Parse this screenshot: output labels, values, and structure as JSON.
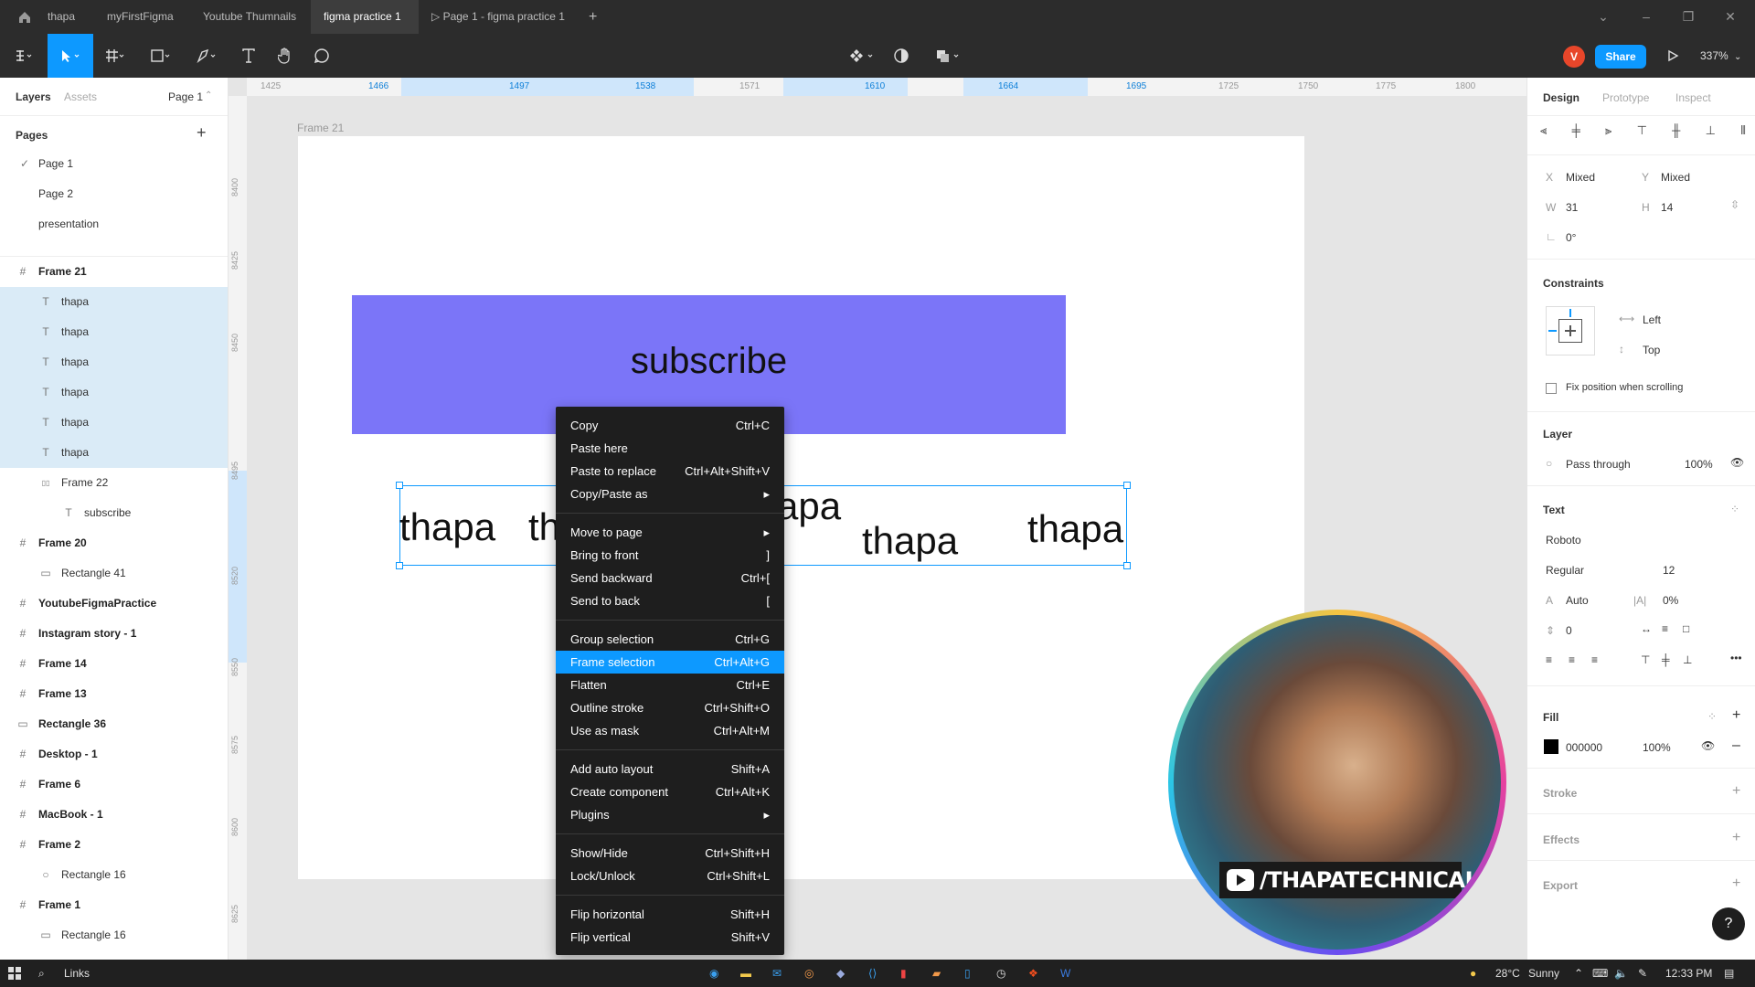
{
  "window": {
    "tabs": [
      {
        "label": "thapa"
      },
      {
        "label": "myFirstFigma"
      },
      {
        "label": "Youtube Thumnails"
      },
      {
        "label": "figma practice 1"
      },
      {
        "label": "Page 1 - figma practice 1"
      }
    ],
    "new_tab_symbol": "+"
  },
  "toolbar": {
    "avatar_letter": "V",
    "share_label": "Share",
    "zoom": "337%"
  },
  "left_panel": {
    "tabs": {
      "layers": "Layers",
      "assets": "Assets",
      "page": "Page 1"
    },
    "pages_header": "Pages",
    "pages": [
      {
        "label": "Page 1",
        "current": true
      },
      {
        "label": "Page 2"
      },
      {
        "label": "presentation"
      }
    ],
    "layers": [
      {
        "label": "Frame 21",
        "icon": "frame-icon",
        "indent": 0,
        "selected": false
      },
      {
        "label": "thapa",
        "icon": "text-icon",
        "indent": 1,
        "selected": true
      },
      {
        "label": "thapa",
        "icon": "text-icon",
        "indent": 1,
        "selected": true
      },
      {
        "label": "thapa",
        "icon": "text-icon",
        "indent": 1,
        "selected": true
      },
      {
        "label": "thapa",
        "icon": "text-icon",
        "indent": 1,
        "selected": true
      },
      {
        "label": "thapa",
        "icon": "text-icon",
        "indent": 1,
        "selected": true
      },
      {
        "label": "thapa",
        "icon": "text-icon",
        "indent": 1,
        "selected": true
      },
      {
        "label": "Frame 22",
        "icon": "auto-layout-icon",
        "indent": 1,
        "selected": false
      },
      {
        "label": "subscribe",
        "icon": "text-icon",
        "indent": 2,
        "selected": false
      },
      {
        "label": "Frame 20",
        "icon": "frame-icon",
        "indent": 0,
        "selected": false
      },
      {
        "label": "Rectangle 41",
        "icon": "rectangle-icon",
        "indent": 1,
        "selected": false
      },
      {
        "label": "YoutubeFigmaPractice",
        "icon": "frame-icon",
        "indent": 0,
        "selected": false
      },
      {
        "label": "Instagram story - 1",
        "icon": "frame-icon",
        "indent": 0,
        "selected": false
      },
      {
        "label": "Frame 14",
        "icon": "frame-icon",
        "indent": 0,
        "selected": false
      },
      {
        "label": "Frame 13",
        "icon": "frame-icon",
        "indent": 0,
        "selected": false
      },
      {
        "label": "Rectangle 36",
        "icon": "rectangle-icon",
        "indent": 0,
        "selected": false
      },
      {
        "label": "Desktop - 1",
        "icon": "frame-icon",
        "indent": 0,
        "selected": false
      },
      {
        "label": "Frame 6",
        "icon": "frame-icon",
        "indent": 0,
        "selected": false
      },
      {
        "label": "MacBook - 1",
        "icon": "frame-icon",
        "indent": 0,
        "selected": false
      },
      {
        "label": "Frame 2",
        "icon": "frame-icon",
        "indent": 0,
        "selected": false
      },
      {
        "label": "Rectangle 16",
        "icon": "ellipse-icon",
        "indent": 1,
        "selected": false
      },
      {
        "label": "Frame 1",
        "icon": "frame-icon",
        "indent": 0,
        "selected": false
      },
      {
        "label": "Rectangle 16",
        "icon": "rectangle-icon",
        "indent": 1,
        "selected": false
      }
    ]
  },
  "rulers": {
    "top": [
      "1425",
      "1466",
      "1497",
      "1538",
      "1571",
      "1610",
      "1664",
      "1695",
      "1725",
      "1750",
      "1775",
      "1800"
    ],
    "left": [
      "8400",
      "8425",
      "8450",
      "8495",
      "8520",
      "8550",
      "8575",
      "8600",
      "8625"
    ]
  },
  "canvas": {
    "frame_label": "Frame 21",
    "banner_text": "subscribe",
    "banner_color": "#7b75f8",
    "words": [
      "thapa",
      "th",
      "apa",
      "thapa",
      "thapa"
    ]
  },
  "context_menu": {
    "groups": [
      [
        {
          "label": "Copy",
          "shortcut": "Ctrl+C"
        },
        {
          "label": "Paste here",
          "shortcut": ""
        },
        {
          "label": "Paste to replace",
          "shortcut": "Ctrl+Alt+Shift+V"
        },
        {
          "label": "Copy/Paste as",
          "shortcut": "▸"
        }
      ],
      [
        {
          "label": "Move to page",
          "shortcut": "▸"
        },
        {
          "label": "Bring to front",
          "shortcut": "]"
        },
        {
          "label": "Send backward",
          "shortcut": "Ctrl+["
        },
        {
          "label": "Send to back",
          "shortcut": "["
        }
      ],
      [
        {
          "label": "Group selection",
          "shortcut": "Ctrl+G"
        },
        {
          "label": "Frame selection",
          "shortcut": "Ctrl+Alt+G",
          "highlighted": true
        },
        {
          "label": "Flatten",
          "shortcut": "Ctrl+E"
        },
        {
          "label": "Outline stroke",
          "shortcut": "Ctrl+Shift+O"
        },
        {
          "label": "Use as mask",
          "shortcut": "Ctrl+Alt+M"
        }
      ],
      [
        {
          "label": "Add auto layout",
          "shortcut": "Shift+A"
        },
        {
          "label": "Create component",
          "shortcut": "Ctrl+Alt+K"
        },
        {
          "label": "Plugins",
          "shortcut": "▸"
        }
      ],
      [
        {
          "label": "Show/Hide",
          "shortcut": "Ctrl+Shift+H"
        },
        {
          "label": "Lock/Unlock",
          "shortcut": "Ctrl+Shift+L"
        }
      ],
      [
        {
          "label": "Flip horizontal",
          "shortcut": "Shift+H"
        },
        {
          "label": "Flip vertical",
          "shortcut": "Shift+V"
        }
      ]
    ]
  },
  "webcam": {
    "handle": "/THAPATECHNICAL"
  },
  "right_panel": {
    "tabs": {
      "design": "Design",
      "prototype": "Prototype",
      "inspect": "Inspect"
    },
    "x_label": "X",
    "x_value": "Mixed",
    "y_label": "Y",
    "y_value": "Mixed",
    "w_label": "W",
    "w_value": "31",
    "h_label": "H",
    "h_value": "14",
    "rotation": "0°",
    "constraints_header": "Constraints",
    "constraint_h": "Left",
    "constraint_v": "Top",
    "fix_position": "Fix position when scrolling",
    "layer_header": "Layer",
    "blend_mode": "Pass through",
    "layer_opacity": "100%",
    "text_header": "Text",
    "font_family": "Roboto",
    "font_style": "Regular",
    "font_size": "12",
    "line_height": "Auto",
    "letter_spacing": "0%",
    "paragraph_spacing": "0",
    "fill_header": "Fill",
    "fill_hex": "000000",
    "fill_opacity": "100%",
    "fill_color": "#000000",
    "stroke_header": "Stroke",
    "effects_header": "Effects",
    "export_header": "Export",
    "help": "?"
  },
  "taskbar": {
    "search_text": "Links",
    "weather": "28°C",
    "weather_desc": "Sunny",
    "time": "12:33 PM"
  }
}
